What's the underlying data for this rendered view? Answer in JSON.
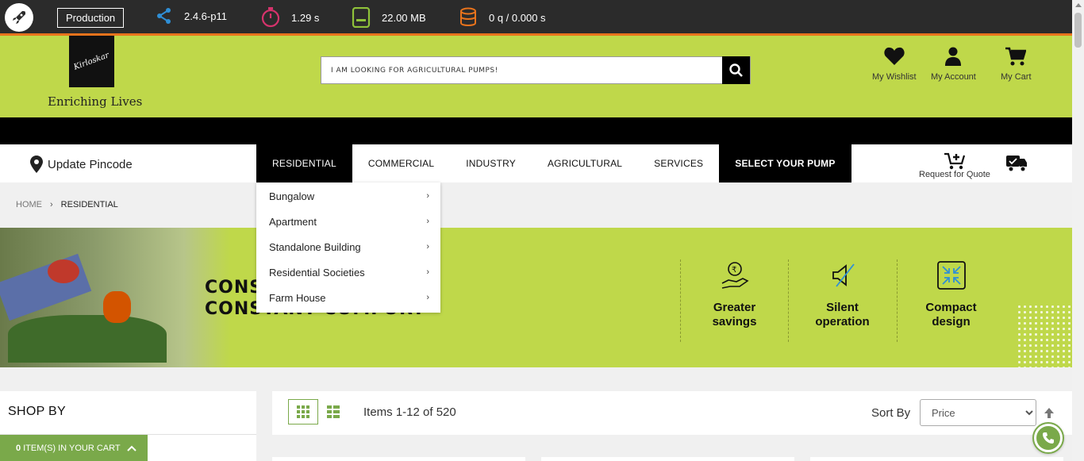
{
  "debugbar": {
    "environment": "Production",
    "version": "2.4.6-p11",
    "time": "1.29 s",
    "memory": "22.00 MB",
    "queries": "0 q / 0.000 s"
  },
  "header": {
    "logo_text": "Kirloskar",
    "tagline": "Enriching Lives",
    "search_placeholder": "I AM LOOKING FOR AGRICULTURAL PUMPS!",
    "wishlist": "My Wishlist",
    "account": "My Account",
    "cart": "My Cart"
  },
  "nav": {
    "pincode": "Update Pincode",
    "items": [
      "RESIDENTIAL",
      "COMMERCIAL",
      "INDUSTRY",
      "AGRICULTURAL",
      "SERVICES",
      "SELECT YOUR PUMP"
    ],
    "quote": "Request for Quote"
  },
  "breadcrumb": {
    "home": "HOME",
    "current": "RESIDENTIAL"
  },
  "dropdown": [
    "Bungalow",
    "Apartment",
    "Standalone Building",
    "Residential Societies",
    "Farm House"
  ],
  "banner": {
    "headline_1": "CONS",
    "headline_2": "CONSTANT COMFORT",
    "features": [
      {
        "line1": "Greater",
        "line2": "savings",
        "icon": "rupee-hand-icon"
      },
      {
        "line1": "Silent",
        "line2": "operation",
        "icon": "mute-speaker-icon"
      },
      {
        "line1": "Compact",
        "line2": "design",
        "icon": "compress-icon"
      }
    ]
  },
  "sidebar": {
    "title": "SHOP BY",
    "cart_count": "0",
    "cart_text": "ITEM(S) IN YOUR CART"
  },
  "toolbar": {
    "items": "Items 1-12 of 520",
    "sort_label": "Sort By",
    "sort_value": "Price"
  },
  "colors": {
    "lime": "#bfd84a",
    "green": "#7aa94a",
    "orange": "#e8731c"
  }
}
